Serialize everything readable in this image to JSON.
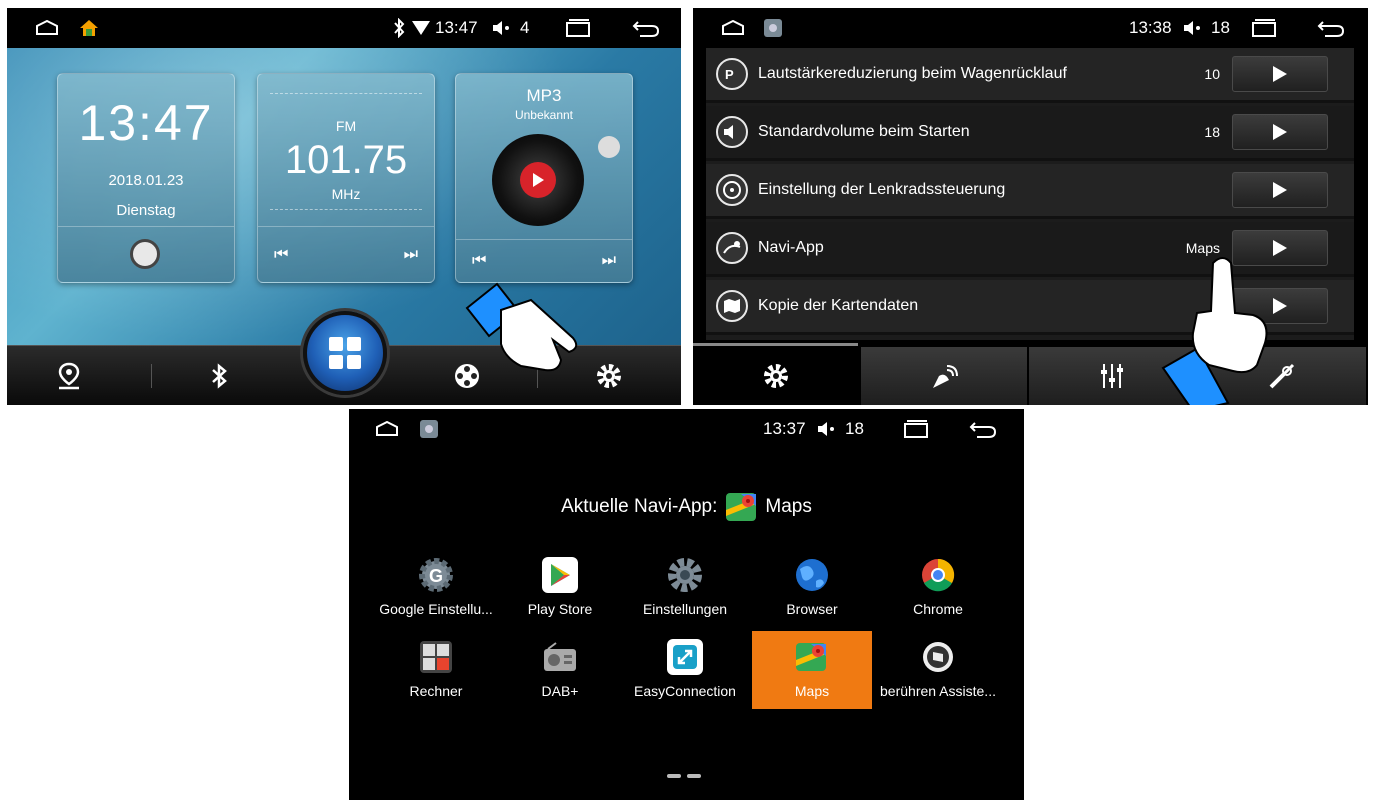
{
  "home": {
    "status": {
      "time": "13:47",
      "volume": "4"
    },
    "clock": {
      "time": "13:47",
      "date": "2018.01.23",
      "weekday": "Dienstag"
    },
    "radio": {
      "band": "FM",
      "frequency": "101.75",
      "unit": "MHz"
    },
    "mp3": {
      "title": "MP3",
      "artist": "Unbekannt"
    },
    "dock": [
      "navigation-icon",
      "bluetooth-icon",
      "apps-icon",
      "video-icon",
      "settings-icon"
    ]
  },
  "settings": {
    "status": {
      "time": "13:38",
      "volume": "18"
    },
    "rows": [
      {
        "label": "Lautstärkereduzierung beim Wagenrücklauf",
        "value": "10",
        "icon": "parking-sound-icon"
      },
      {
        "label": "Standardvolume beim Starten",
        "value": "18",
        "icon": "speaker-icon"
      },
      {
        "label": "Einstellung der Lenkradssteuerung",
        "value": "",
        "icon": "steering-wheel-icon"
      },
      {
        "label": "Navi-App",
        "value": "Maps",
        "icon": "navi-icon"
      },
      {
        "label": "Kopie der Kartendaten",
        "value": "",
        "icon": "map-icon"
      }
    ],
    "tabs": [
      "settings-gear-icon",
      "satellite-icon",
      "equalizer-icon",
      "tools-icon"
    ]
  },
  "navi": {
    "status": {
      "time": "13:37",
      "volume": "18"
    },
    "title_prefix": "Aktuelle Navi-App:",
    "current_app": "Maps",
    "apps_row1": [
      {
        "label": "Google Einstellu...",
        "icon": "google-settings-icon"
      },
      {
        "label": "Play Store",
        "icon": "play-store-icon"
      },
      {
        "label": "Einstellungen",
        "icon": "settings-icon"
      },
      {
        "label": "Browser",
        "icon": "globe-icon"
      },
      {
        "label": "Chrome",
        "icon": "chrome-icon"
      }
    ],
    "apps_row2": [
      {
        "label": "Rechner",
        "icon": "calculator-icon"
      },
      {
        "label": "DAB+",
        "icon": "radio-icon"
      },
      {
        "label": "EasyConnection",
        "icon": "easyconnection-icon"
      },
      {
        "label": "Maps",
        "icon": "maps-icon",
        "selected": true
      },
      {
        "label": "berühren Assiste...",
        "icon": "touch-assistant-icon"
      }
    ]
  },
  "colors": {
    "accent_orange": "#f07a12",
    "blue_highlight": "#1f5fb6"
  }
}
